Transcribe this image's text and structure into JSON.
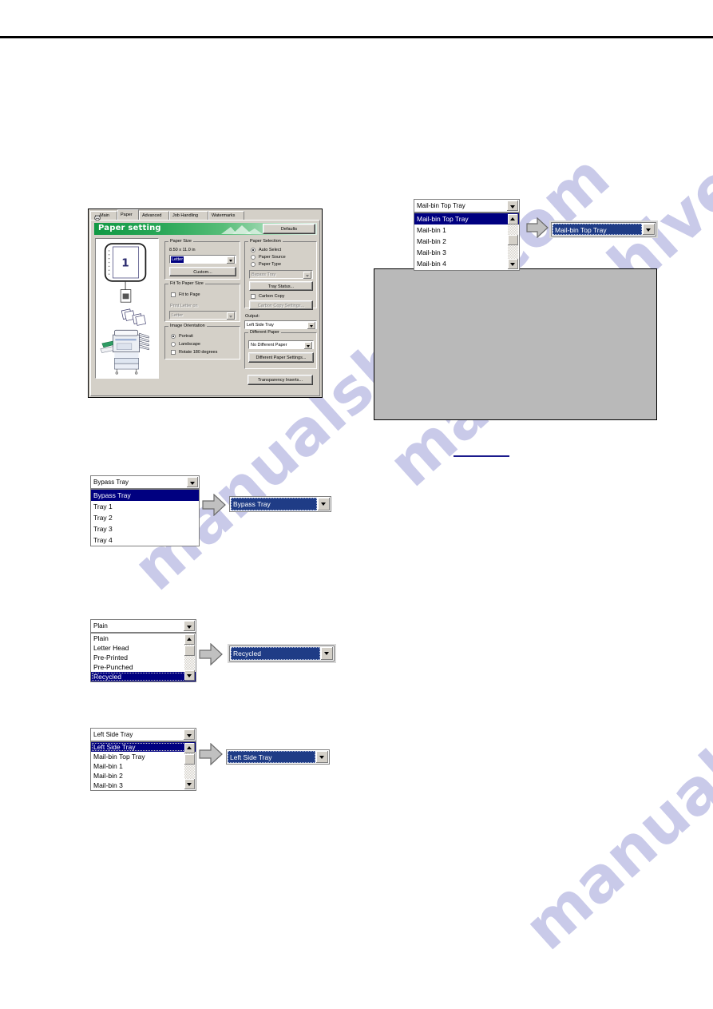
{
  "page": {
    "watermark_text": "manualshive.com",
    "watermark_color": "#a9abdc",
    "rule_color": "#000000"
  },
  "dialog": {
    "tabs": [
      {
        "label": "Main",
        "selected": false,
        "icon": "printer-icon"
      },
      {
        "label": "Paper",
        "selected": true
      },
      {
        "label": "Advanced",
        "selected": false
      },
      {
        "label": "Job Handling",
        "selected": false
      },
      {
        "label": "Watermarks",
        "selected": false
      }
    ],
    "banner_title": "Paper setting",
    "defaults_button": "Defaults",
    "preview": {
      "page_number": "1"
    },
    "paper_size": {
      "group_label": "Paper Size",
      "dimensions": "8.50 x 11.0 in",
      "value": "Letter",
      "custom_button": "Custom..."
    },
    "fit_to_paper_size": {
      "group_label": "Fit To Paper Size",
      "fit_to_page_label": "Fit to Page",
      "fit_to_page_checked": false,
      "print_letter_on_label": "Print Letter on",
      "print_letter_on_value": "Letter"
    },
    "image_orientation": {
      "group_label": "Image Orientation",
      "portrait_label": "Portrait",
      "landscape_label": "Landscape",
      "selected": "Portrait",
      "rotate_label": "Rotate 180 degrees",
      "rotate_checked": false
    },
    "paper_selection": {
      "group_label": "Paper Selection",
      "options": [
        {
          "label": "Auto Select",
          "selected": true
        },
        {
          "label": "Paper Source",
          "selected": false
        },
        {
          "label": "Paper Type",
          "selected": false
        }
      ],
      "source_value": "Bypass Tray",
      "source_disabled": true,
      "tray_status_button": "Tray Status...",
      "carbon_copy_label": "Carbon Copy",
      "carbon_copy_checked": false,
      "carbon_copy_settings_button": "Carbon Copy Settings...",
      "carbon_copy_settings_disabled": true
    },
    "output": {
      "label": "Output:",
      "value": "Left Side Tray"
    },
    "different_paper": {
      "group_label": "Different Paper",
      "value": "No Different Paper",
      "settings_button": "Different Paper Settings..."
    },
    "transparency_button": "Transparency Inserts..."
  },
  "examples": [
    {
      "id": "mailbin-output",
      "closed_value": "Mail-bin Top Tray",
      "options": [
        "Mail-bin Top Tray",
        "Mail-bin 1",
        "Mail-bin 2",
        "Mail-bin 3",
        "Mail-bin 4"
      ],
      "highlighted_index": 0,
      "has_scrollbar": true,
      "result_value": "Mail-bin Top Tray"
    },
    {
      "id": "paper-source",
      "closed_value": "Bypass Tray",
      "options": [
        "Bypass Tray",
        "Tray 1",
        "Tray 2",
        "Tray 3",
        "Tray 4"
      ],
      "highlighted_index": 0,
      "has_scrollbar": false,
      "result_value": "Bypass Tray"
    },
    {
      "id": "paper-type",
      "closed_value": "Plain",
      "options": [
        "Plain",
        "Letter Head",
        "Pre-Printed",
        "Pre-Punched",
        "Recycled"
      ],
      "highlighted_index": 4,
      "has_scrollbar": true,
      "result_value": "Recycled"
    },
    {
      "id": "output-tray",
      "closed_value": "Left Side Tray",
      "options": [
        "Left Side Tray",
        "Mail-bin Top Tray",
        "Mail-bin 1",
        "Mail-bin 2",
        "Mail-bin 3"
      ],
      "highlighted_index": 0,
      "has_scrollbar": true,
      "result_value": "Left Side Tray"
    }
  ]
}
